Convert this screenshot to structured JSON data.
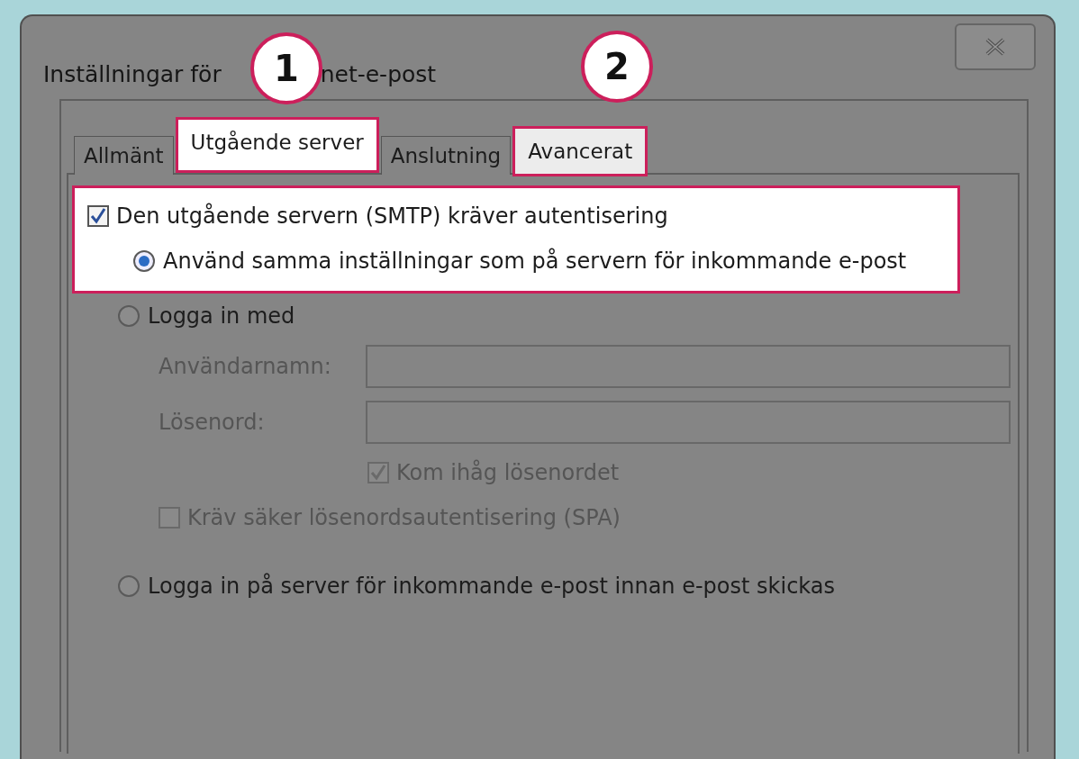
{
  "window": {
    "title_parts": [
      "Inställningar för",
      "net-e-post"
    ]
  },
  "callouts": [
    {
      "number": "1"
    },
    {
      "number": "2"
    }
  ],
  "tabs": [
    {
      "label": "Allmänt",
      "selected": false,
      "highlighted": false
    },
    {
      "label": "Utgående server",
      "selected": true,
      "highlighted": true
    },
    {
      "label": "Anslutning",
      "selected": false,
      "highlighted": false
    },
    {
      "label": "Avancerat",
      "selected": false,
      "highlighted": true
    }
  ],
  "groups": [
    {
      "highlighted": true,
      "items": [
        {
          "kind": "checkbox",
          "label": "Den utgående servern (SMTP) kräver autentisering",
          "checked": true,
          "disabled": false
        },
        {
          "kind": "radio",
          "label": "Använd samma inställningar som på servern för inkommande e-post",
          "selected": true,
          "disabled": false
        }
      ]
    },
    {
      "highlighted": false,
      "items": [
        {
          "kind": "radio",
          "label": "Logga in med",
          "selected": false,
          "disabled": false
        },
        {
          "kind": "field",
          "label": "Användarnamn:",
          "disabled": true
        },
        {
          "kind": "field",
          "label": "Lösenord:",
          "disabled": true
        },
        {
          "kind": "field-checkbox",
          "label": "Kom ihåg lösenordet",
          "checked": true,
          "disabled": true
        },
        {
          "kind": "sub-checkbox",
          "label": "Kräv säker lösenordsautentisering (SPA)",
          "checked": false,
          "disabled": true
        },
        {
          "kind": "radio-gap",
          "label": "Logga in på server för inkommande e-post innan e-post skickas",
          "selected": false,
          "disabled": false
        }
      ]
    }
  ]
}
